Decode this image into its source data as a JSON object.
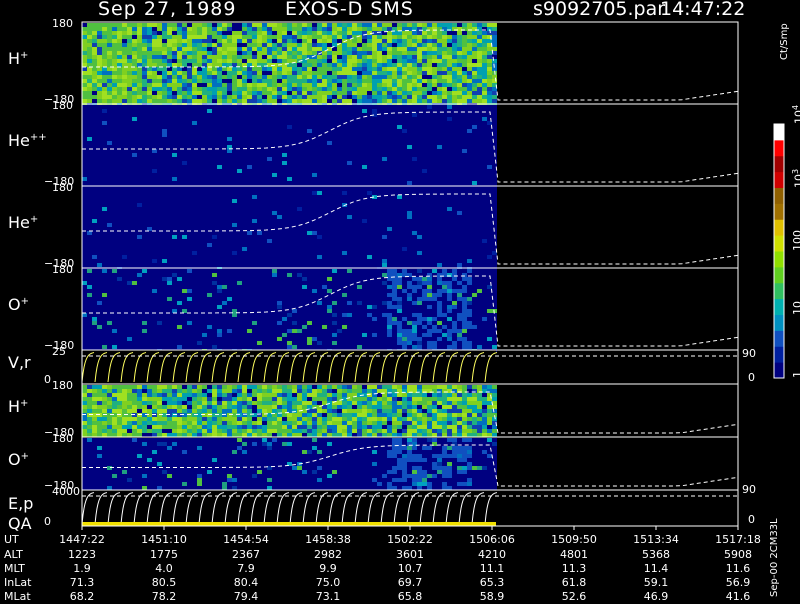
{
  "header": {
    "date": "Sep 27, 1989",
    "satellite": "EXOS-D SMS",
    "file": "s9092705.par",
    "time": "14:47:22"
  },
  "panels": [
    {
      "id": "hplus1",
      "label": "H",
      "sup": "+",
      "ymax": "180",
      "ymin": "−180",
      "palette": "green"
    },
    {
      "id": "hepp",
      "label": "He",
      "sup": "++",
      "ymax": "180",
      "ymin": "−180",
      "palette": "dark"
    },
    {
      "id": "hep",
      "label": "He",
      "sup": "+",
      "ymax": "180",
      "ymin": "−180",
      "palette": "dark"
    },
    {
      "id": "oplus1",
      "label": "O",
      "sup": "+",
      "ymax": "180",
      "ymin": "−180",
      "palette": "oxy"
    },
    {
      "id": "vr",
      "label": "V,r",
      "sup": "",
      "ymax": "25",
      "ymin": "0",
      "rtop": "90",
      "rbot": "0"
    },
    {
      "id": "hplus2",
      "label": "H",
      "sup": "+",
      "ymax": "180",
      "ymin": "−180",
      "palette": "green"
    },
    {
      "id": "oplus2",
      "label": "O",
      "sup": "+",
      "ymax": "180",
      "ymin": "−180",
      "palette": "oxy"
    },
    {
      "id": "ep",
      "label": "E,p",
      "sup": "",
      "label2": "QA",
      "ymax": "4000",
      "ymin": "0",
      "rtop": "90",
      "rbot": "0"
    }
  ],
  "colorbar": {
    "unit": "Ct/Smp",
    "ticks": [
      {
        "label": "10",
        "sup": "4",
        "v": 1.0
      },
      {
        "label": "10",
        "sup": "3",
        "v": 0.75
      },
      {
        "label": "100",
        "sup": "",
        "v": 0.5
      },
      {
        "label": "10",
        "sup": "",
        "v": 0.25
      },
      {
        "label": "1",
        "sup": "",
        "v": 0.0
      }
    ],
    "colors": [
      "#000080",
      "#0020a0",
      "#1050c0",
      "#0090c0",
      "#00b0b0",
      "#30c060",
      "#60d020",
      "#90e000",
      "#d0e000",
      "#e0c000",
      "#a07000",
      "#906000",
      "#d00000",
      "#a00000",
      "#ff0000",
      "#ffffff"
    ]
  },
  "footer": {
    "rows": [
      {
        "name": "UT",
        "values": [
          "1447:22",
          "1451:10",
          "1454:54",
          "1458:38",
          "1502:22",
          "1506:06",
          "1509:50",
          "1513:34",
          "1517:18"
        ]
      },
      {
        "name": "ALT",
        "values": [
          "1223",
          "1775",
          "2367",
          "2982",
          "3601",
          "4210",
          "4801",
          "5368",
          "5908"
        ]
      },
      {
        "name": "MLT",
        "values": [
          "1.9",
          "4.0",
          "7.9",
          "9.9",
          "10.7",
          "11.1",
          "11.3",
          "11.4",
          "11.6"
        ]
      },
      {
        "name": "InLat",
        "values": [
          "71.3",
          "80.5",
          "80.4",
          "75.0",
          "69.7",
          "65.3",
          "61.8",
          "59.1",
          "56.9"
        ]
      },
      {
        "name": "MLat",
        "values": [
          "68.2",
          "78.2",
          "79.4",
          "73.1",
          "65.8",
          "58.9",
          "52.6",
          "46.9",
          "41.6"
        ]
      }
    ],
    "note": "Sep-00 2CM33L"
  },
  "chart_data": {
    "type": "heatmap",
    "title": "Sep 27, 1989  EXOS-D SMS",
    "x": [
      "1447:22",
      "1451:10",
      "1454:54",
      "1458:38",
      "1502:22",
      "1506:06",
      "1509:50",
      "1513:34",
      "1517:18"
    ],
    "data_end_fraction": 0.5,
    "panels": [
      "H+",
      "He++",
      "He+",
      "O+",
      "V,r",
      "H+",
      "O+",
      "E,p QA"
    ],
    "pitch_angle_range": [
      -180,
      180
    ],
    "velocity_range": [
      0,
      25
    ],
    "energy_range": [
      0,
      4000
    ],
    "colorbar_unit": "Ct/Smp",
    "colorbar_range": [
      1,
      10000
    ]
  }
}
